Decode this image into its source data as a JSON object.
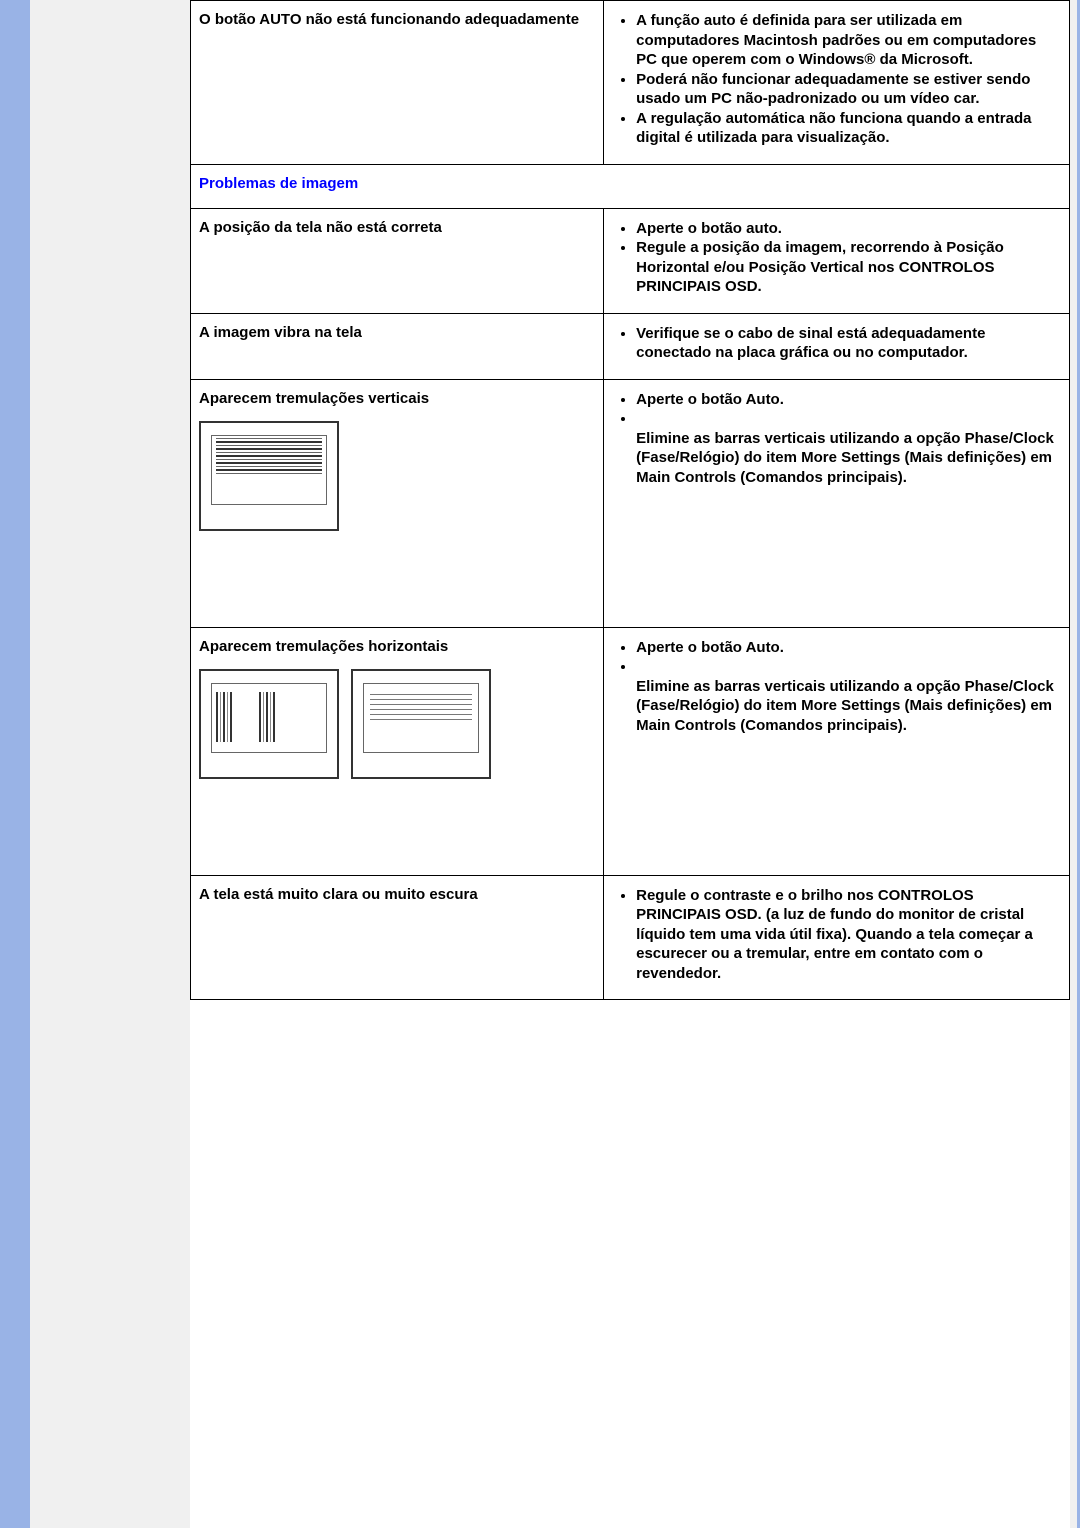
{
  "rows": {
    "r1_left": "O botão AUTO não está funcionando adequadamente",
    "r1_b1": "A função auto é definida para ser utilizada em computadores Macintosh padrões ou em computadores PC que operem com o Windows® da Microsoft.",
    "r1_b2": "Poderá não funcionar adequadamente se  estiver sendo usado um PC não-padronizado ou um vídeo car.",
    "r1_b3": "A regulação automática não funciona quando a entrada digital é utilizada para visualização.",
    "header": "Problemas de imagem",
    "r2_left": "A posição da tela não está correta",
    "r2_b1": "Aperte o botão auto.",
    "r2_b2": "Regule a posição da imagem, recorrendo à Posição Horizontal e/ou Posição Vertical nos CONTROLOS PRINCIPAIS OSD.",
    "r3_left": "A imagem vibra na tela",
    "r3_b1": "Verifique se o cabo de sinal está adequadamente conectado na placa gráfica ou no computador.",
    "r4_left": "Aparecem tremulações verticais",
    "r4_b1": "Aperte o botão Auto.",
    "r4_b2": "Elimine as barras verticais utilizando a opção Phase/Clock (Fase/Relógio) do item More Settings (Mais definições) em Main Controls (Comandos principais).",
    "r5_left": "Aparecem tremulações horizontais",
    "r5_b1": "Aperte o botão Auto.",
    "r5_b2": "Elimine as barras verticais utilizando a opção Phase/Clock (Fase/Relógio) do item More Settings (Mais definições) em Main Controls (Comandos principais).",
    "r6_left": "A tela está muito clara ou muito escura",
    "r6_b1": "Regule o contraste e o brilho nos CONTROLOS PRINCIPAIS OSD. (a luz de fundo do monitor de cristal líquido tem uma vida útil fixa). Quando a tela começar a escurecer ou a tremular, entre em contato com o revendedor."
  }
}
